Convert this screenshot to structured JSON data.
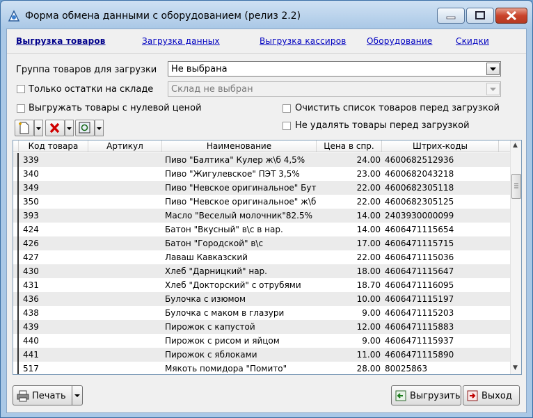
{
  "window": {
    "title": "Форма обмена данными с оборудованием (релиз 2.2)"
  },
  "tabs": [
    {
      "label": "Выгрузка товаров",
      "active": true
    },
    {
      "label": "Загрузка данных",
      "active": false
    },
    {
      "label": "Выгрузка кассиров",
      "active": false
    },
    {
      "label": "Оборудование",
      "active": false
    },
    {
      "label": "Скидки",
      "active": false
    }
  ],
  "form": {
    "group_label": "Группа товаров для загрузки",
    "group_value": "Не выбрана",
    "stock_only_label": "Только остатки на складе",
    "stock_only_checked": false,
    "warehouse_value": "Склад не выбран",
    "zero_price_label": "Выгружать товары с нулевой ценой",
    "zero_price_checked": false,
    "clear_list_label": "Очистить список товаров перед загрузкой",
    "clear_list_checked": false,
    "no_delete_label": "Не удалять товары перед загрузкой",
    "no_delete_checked": false
  },
  "table": {
    "columns": [
      "Код товара",
      "Артикул",
      "Наименование",
      "Цена в спр.",
      "Штрих-коды"
    ],
    "rows": [
      [
        "339",
        "",
        "Пиво \"Балтика\" Кулер ж\\б 4,5%",
        "24.00",
        "4600682512936"
      ],
      [
        "340",
        "",
        "Пиво \"Жигулевское\"  ПЭТ 3,5%",
        "23.00",
        "4600682043218"
      ],
      [
        "349",
        "",
        "Пиво \"Невское оригинальное\"  Бут",
        "22.00",
        "4600682305118"
      ],
      [
        "350",
        "",
        "Пиво \"Невское оригинальное\"  ж\\б",
        "22.00",
        "4600682305125"
      ],
      [
        "393",
        "",
        "Масло \"Веселый молочник\"82.5%",
        "14.00",
        "2403930000099"
      ],
      [
        "424",
        "",
        "Батон \"Вкусный\" в\\с в нар.",
        "14.00",
        "4606471115654"
      ],
      [
        "426",
        "",
        "Батон \"Городской\" в\\с",
        "17.00",
        "4606471115715"
      ],
      [
        "427",
        "",
        "Лаваш Кавказский",
        "22.00",
        "4606471115036"
      ],
      [
        "430",
        "",
        "Хлеб \"Дарницкий\" нар.",
        "18.00",
        "4606471115647"
      ],
      [
        "431",
        "",
        "Хлеб \"Докторский\" с отрубями",
        "18.70",
        "4606471116095"
      ],
      [
        "436",
        "",
        "Булочка с изюмом",
        "10.00",
        "4606471115197"
      ],
      [
        "438",
        "",
        "Булочка с маком в глазури",
        "9.00",
        "4606471115203"
      ],
      [
        "439",
        "",
        "Пирожок с капустой",
        "12.00",
        "4606471115883"
      ],
      [
        "440",
        "",
        "Пирожок с рисом и яйцом",
        "9.00",
        "4606471115937"
      ],
      [
        "441",
        "",
        "Пирожок с яблоками",
        "11.00",
        "4606471115890"
      ],
      [
        "517",
        "",
        "Мякоть помидора \"Помито\"",
        "28.00",
        "80025863"
      ]
    ]
  },
  "buttons": {
    "print": "Печать",
    "export": "Выгрузить",
    "exit": "Выход"
  },
  "colors": {
    "link": "#0000c0",
    "title_bg": "#aac8e6",
    "close_btn": "#c9432b"
  }
}
